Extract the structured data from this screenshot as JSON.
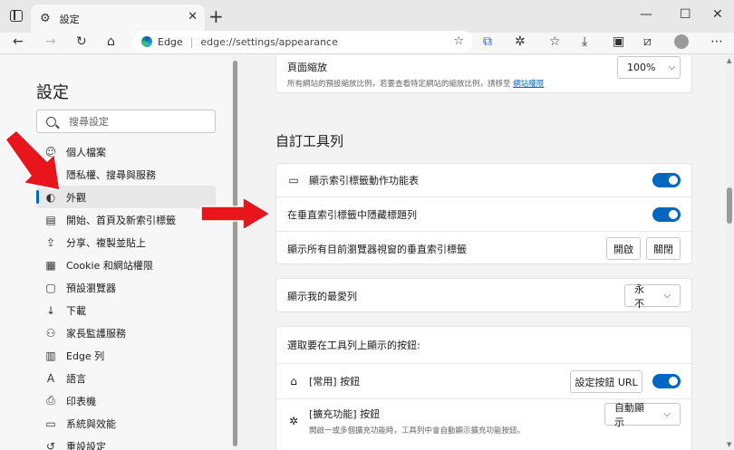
{
  "tab": {
    "title": "設定"
  },
  "address": {
    "brand": "Edge",
    "url": "edge://settings/appearance"
  },
  "sidebar": {
    "title": "設定",
    "search_placeholder": "搜尋設定",
    "items": [
      {
        "label": "個人檔案",
        "icon": "profile-icon"
      },
      {
        "label": "隱私權、搜尋與服務",
        "icon": "lock-icon"
      },
      {
        "label": "外觀",
        "icon": "palette-icon",
        "active": true
      },
      {
        "label": "開始、首頁及新索引標籤",
        "icon": "home-page-icon"
      },
      {
        "label": "分享、複製並貼上",
        "icon": "share-icon"
      },
      {
        "label": "Cookie 和網站權限",
        "icon": "cookie-icon"
      },
      {
        "label": "預設瀏覽器",
        "icon": "browser-icon"
      },
      {
        "label": "下載",
        "icon": "download-icon"
      },
      {
        "label": "家長監護服務",
        "icon": "family-icon"
      },
      {
        "label": "Edge 列",
        "icon": "edge-bar-icon"
      },
      {
        "label": "語言",
        "icon": "language-icon"
      },
      {
        "label": "印表機",
        "icon": "printer-icon"
      },
      {
        "label": "系統與效能",
        "icon": "system-icon"
      },
      {
        "label": "重設設定",
        "icon": "reset-icon"
      }
    ]
  },
  "zoom": {
    "label": "頁面縮放",
    "description": "所有網站的預設縮放比例，若要查看特定網站的縮放比例，請移至",
    "link": "網站權限",
    "value": "100%"
  },
  "toolbar_section": {
    "title": "自訂工具列",
    "rows": [
      {
        "label": "顯示索引標籤動作功能表",
        "toggle": "on"
      },
      {
        "label": "在垂直索引標籤中隱藏標題列",
        "toggle": "on"
      },
      {
        "label": "顯示所有目前瀏覽器視窗的垂直索引標籤",
        "btn_on": "開啟",
        "btn_off": "關閉"
      }
    ]
  },
  "favorites": {
    "label": "顯示我的最愛列",
    "value": "永不"
  },
  "buttons_section": {
    "title": "選取要在工具列上顯示的按鈕:",
    "home": {
      "label": "[常用] 按鈕",
      "button": "設定按鈕 URL",
      "toggle": "on"
    },
    "extensions": {
      "label": "[擴充功能] 按鈕",
      "description": "開啟一或多個擴充功能時，工具列中會自動顯示擴充功能按鈕。",
      "value": "自動顯示"
    }
  },
  "colors": {
    "accent": "#0067c0",
    "arrow": "#e8151c"
  }
}
